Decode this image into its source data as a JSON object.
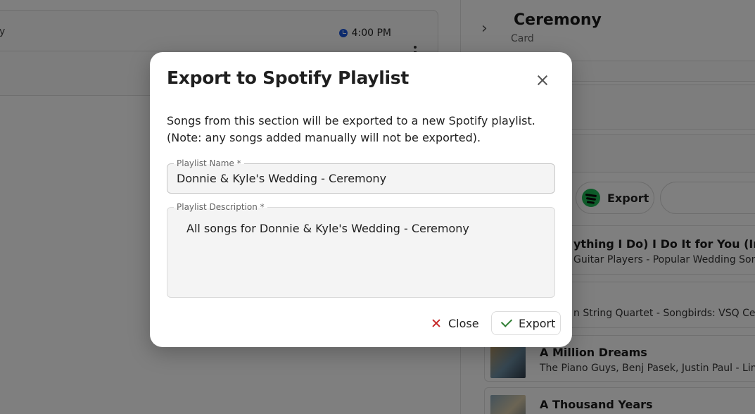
{
  "background": {
    "event_card": {
      "left_glyph": "y",
      "time": "4:00 PM"
    },
    "section": {
      "title": "Ceremony",
      "subtitle": "Card",
      "export_label": "Export"
    },
    "songs": [
      {
        "title": "ything I Do) I Do It for You (Instru",
        "artist": "Guitar Players - Popular Wedding Song"
      },
      {
        "title": "",
        "artist": "n String Quartet - Songbirds: VSQ Celeb"
      },
      {
        "title": "A Million Dreams",
        "artist": "The Piano Guys, Benj Pasek, Justin Paul - Limit"
      },
      {
        "title": "A Thousand Years",
        "artist": ""
      }
    ]
  },
  "modal": {
    "title": "Export to Spotify Playlist",
    "description": "Songs from this section will be exported to a new Spotify playlist. (Note: any songs added manually will not be exported).",
    "playlist_name": {
      "label": "Playlist Name *",
      "value": "Donnie & Kyle's Wedding - Ceremony"
    },
    "playlist_description": {
      "label": "Playlist Description *",
      "value": "All songs for Donnie & Kyle's Wedding - Ceremony"
    },
    "close_label": "Close",
    "export_label": "Export"
  },
  "colors": {
    "spotify_green": "#1db954",
    "close_red": "#c62828",
    "check_green": "#2e7d32",
    "clock_blue": "#1a56db"
  },
  "icons": [
    "clock-icon",
    "kebab-menu-icon",
    "chevron-right-icon",
    "spotify-icon",
    "close-icon",
    "check-icon"
  ]
}
